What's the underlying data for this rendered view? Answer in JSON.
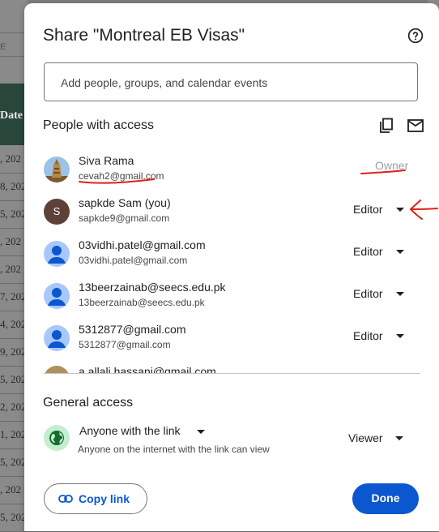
{
  "background": {
    "header_text": "Date",
    "top_label": "E",
    "row_labels": [
      ", 202",
      "8, 202",
      "5, 202",
      ", 202",
      ", 202",
      "7, 202",
      "4, 202",
      "9, 202",
      "5, 202",
      "2, 202",
      "1, 202",
      "5, 202",
      ", 202",
      "5, 202"
    ]
  },
  "dialog": {
    "title": "Share \"Montreal EB Visas\"",
    "icons": {
      "help": "help-circle-icon",
      "copy": "copy-icon",
      "mail": "mail-icon"
    },
    "input_placeholder": "Add people, groups, and calendar events",
    "people_heading": "People with access",
    "people": [
      {
        "name": "Siva Rama",
        "email": "cevah2@gmail.com",
        "role": "Owner",
        "avatar": "photo"
      },
      {
        "name": "sapkde Sam (you)",
        "email": "sapkde9@gmail.com",
        "role": "Editor",
        "avatar": "S"
      },
      {
        "name": "03vidhi.patel@gmail.com",
        "email": "03vidhi.patel@gmail.com",
        "role": "Editor",
        "avatar": "person"
      },
      {
        "name": "13beerzainab@seecs.edu.pk",
        "email": "13beerzainab@seecs.edu.pk",
        "role": "Editor",
        "avatar": "person"
      },
      {
        "name": "5312877@gmail.com",
        "email": "5312877@gmail.com",
        "role": "Editor",
        "avatar": "person"
      },
      {
        "name": "a.allali.hassani@gmail.com",
        "email": "",
        "role": "",
        "avatar": "photo"
      }
    ],
    "general_access": {
      "heading": "General access",
      "title": "Anyone with the link",
      "subtitle": "Anyone on the internet with the link can view",
      "role": "Viewer"
    },
    "copy_link_label": "Copy link",
    "done_label": "Done",
    "colors": {
      "primary": "#0b57d0",
      "annotation": "#e0201c",
      "avatar_s": "#5d4037",
      "avatar_person": "#a8c7fa"
    }
  }
}
